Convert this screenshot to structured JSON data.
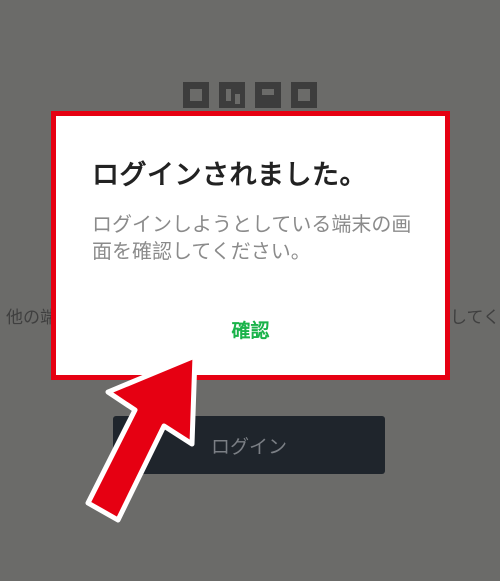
{
  "background": {
    "logo_icon": "qr-logo-icon",
    "text_left": "他の端",
    "text_right": "してく",
    "login_button_label": "ログイン"
  },
  "dialog": {
    "title": "ログインされました。",
    "message": "ログインしようとしている端末の画面を確認してください。",
    "confirm_label": "確認"
  },
  "annotation": {
    "arrow_icon": "red-arrow-icon",
    "arrow_color": "#e60012",
    "outline_color": "#e60012"
  },
  "colors": {
    "overlay_bg": "#6b6b69",
    "confirm_green": "#1ab34a"
  }
}
